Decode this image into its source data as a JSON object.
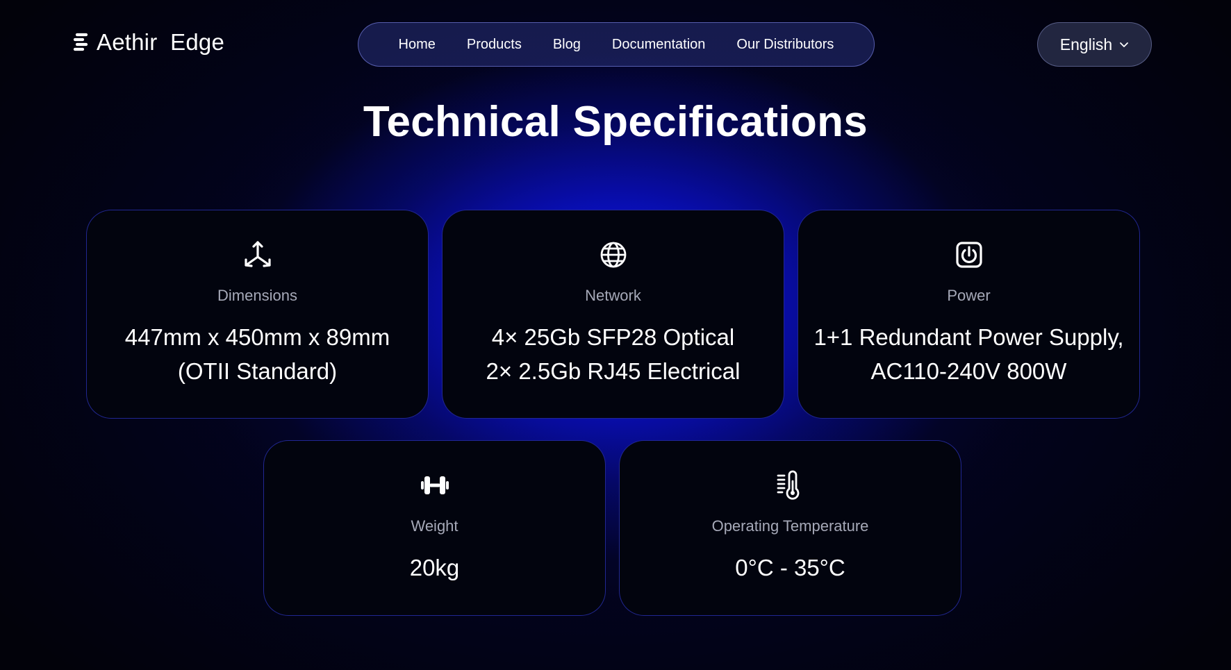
{
  "brand": {
    "name": "Aethir  Edge",
    "icon": "aethir-logo-icon"
  },
  "nav": {
    "items": [
      {
        "label": "Home"
      },
      {
        "label": "Products"
      },
      {
        "label": "Blog"
      },
      {
        "label": "Documentation"
      },
      {
        "label": "Our Distributors"
      }
    ]
  },
  "language": {
    "selected": "English",
    "icon": "chevron-down-icon"
  },
  "page": {
    "title": "Technical Specifications"
  },
  "specs": [
    {
      "icon": "dimensions-axes-icon",
      "label": "Dimensions",
      "lines": [
        "447mm x 450mm x 89mm",
        "(OTII Standard)"
      ]
    },
    {
      "icon": "globe-icon",
      "label": "Network",
      "lines": [
        "4× 25Gb SFP28 Optical",
        "2× 2.5Gb RJ45 Electrical"
      ]
    },
    {
      "icon": "power-icon",
      "label": "Power",
      "lines": [
        "1+1 Redundant Power Supply,",
        "AC110-240V 800W"
      ]
    },
    {
      "icon": "dumbbell-icon",
      "label": "Weight",
      "lines": [
        "20kg"
      ]
    },
    {
      "icon": "thermometer-icon",
      "label": "Operating Temperature",
      "lines": [
        "0°C - 35°C"
      ]
    }
  ],
  "colors": {
    "background": "#02020a",
    "glow": "#1018ff",
    "card_background": "#02040e",
    "card_border": "#3c46ff",
    "label_text": "#a6a9b8",
    "value_text": "#ffffff"
  }
}
